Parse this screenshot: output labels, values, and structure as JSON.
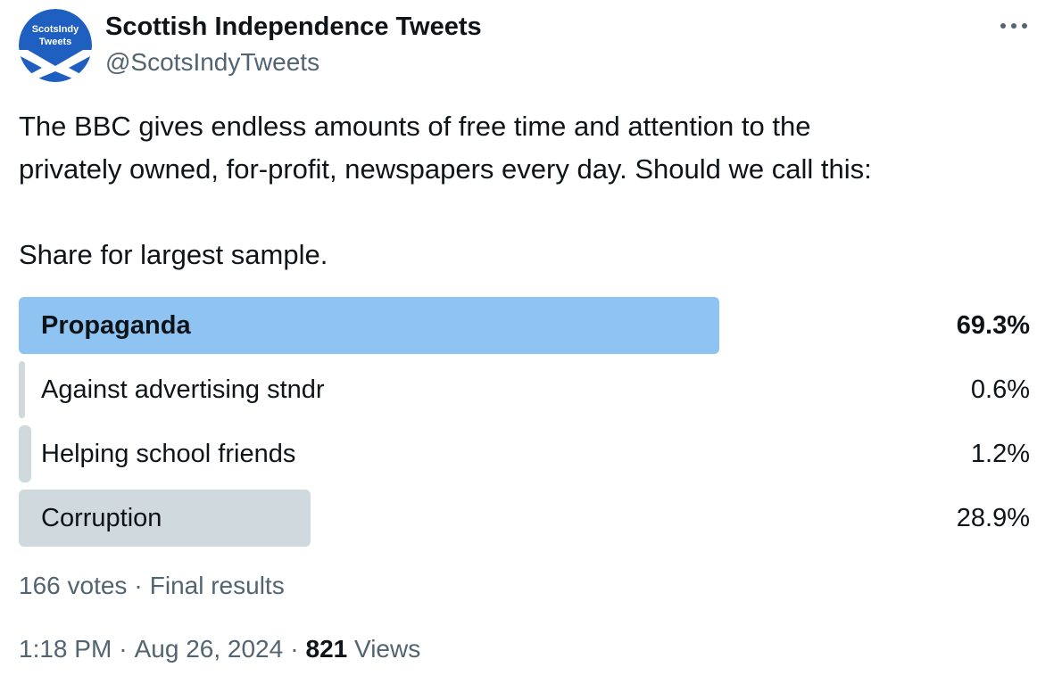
{
  "author": {
    "display_name": "Scottish Independence Tweets",
    "handle": "@ScotsIndyTweets",
    "avatar_text_line1": "ScotsIndy",
    "avatar_text_line2": "Tweets",
    "avatar_icon": "saltire-avatar",
    "avatar_bg": "#1f5fc0"
  },
  "more_icon": "more-dots-icon",
  "tweet": {
    "text": "The BBC gives endless amounts of free time and attention to the\nprivately owned, for-profit, newspapers every day. Should we call this:\n\nShare for largest sample."
  },
  "poll": {
    "options": [
      {
        "label": "Propaganda",
        "percent_text": "69.3%",
        "percent": 69.3,
        "winner": true
      },
      {
        "label": "Against advertising stndr",
        "percent_text": "0.6%",
        "percent": 0.6,
        "winner": false
      },
      {
        "label": "Helping school friends",
        "percent_text": "1.2%",
        "percent": 1.2,
        "winner": false
      },
      {
        "label": "Corruption",
        "percent_text": "28.9%",
        "percent": 28.9,
        "winner": false
      }
    ],
    "votes": "166 votes",
    "separator": "·",
    "status": "Final results",
    "winner_color": "#8ec3f2",
    "bar_color": "#cfd9de"
  },
  "meta": {
    "time": "1:18 PM",
    "separator": "·",
    "date": "Aug 26, 2024",
    "views_count": "821",
    "views_label": "Views"
  }
}
